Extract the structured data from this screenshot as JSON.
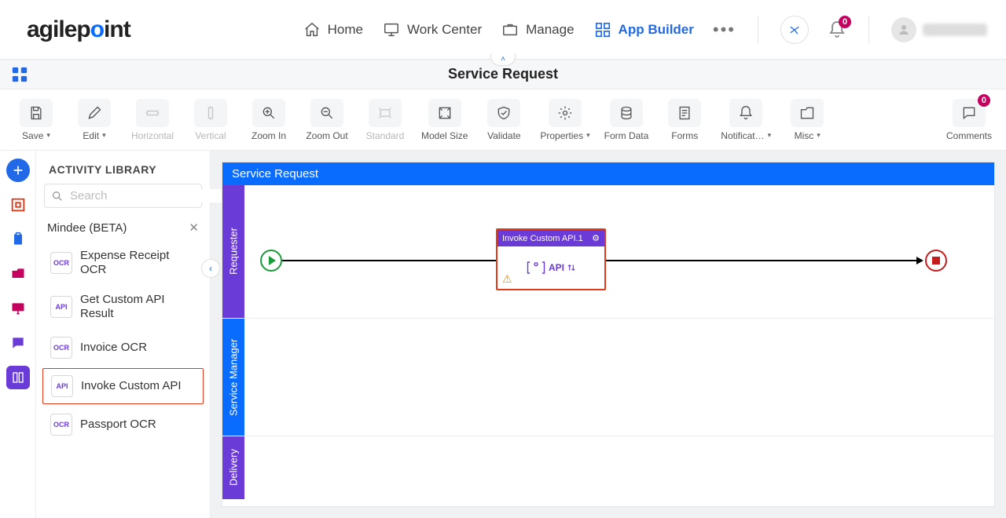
{
  "topnav": {
    "brand_left": "agilep",
    "brand_mid": "o",
    "brand_right": "int",
    "items": [
      {
        "label": "Home"
      },
      {
        "label": "Work Center"
      },
      {
        "label": "Manage"
      },
      {
        "label": "App Builder"
      }
    ],
    "notification_count": "0"
  },
  "subheader": {
    "title": "Service Request"
  },
  "toolbar": {
    "save": "Save",
    "edit": "Edit",
    "horizontal": "Horizontal",
    "vertical": "Vertical",
    "zoom_in": "Zoom In",
    "zoom_out": "Zoom Out",
    "standard": "Standard",
    "model_size": "Model Size",
    "validate": "Validate",
    "properties": "Properties",
    "form_data": "Form Data",
    "forms": "Forms",
    "notifications": "Notificat…",
    "misc": "Misc",
    "comments": "Comments",
    "comments_count": "0"
  },
  "library": {
    "title": "ACTIVITY LIBRARY",
    "search_placeholder": "Search",
    "group": "Mindee (BETA)",
    "items": [
      {
        "icon": "OCR",
        "label": "Expense Receipt OCR"
      },
      {
        "icon": "API",
        "label": "Get Custom API Result"
      },
      {
        "icon": "OCR",
        "label": "Invoice OCR"
      },
      {
        "icon": "API",
        "label": "Invoke Custom API"
      },
      {
        "icon": "OCR",
        "label": "Passport OCR"
      }
    ]
  },
  "canvas": {
    "title": "Service Request",
    "lanes": {
      "requester": "Requester",
      "service_manager": "Service Manager",
      "delivery": "Delivery"
    },
    "activity": {
      "title": "Invoke Custom API.1",
      "api_label": "API"
    }
  }
}
